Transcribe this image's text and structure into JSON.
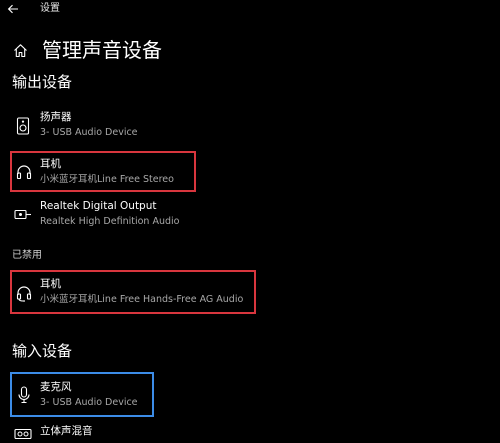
{
  "window": {
    "title": "设置"
  },
  "page": {
    "title": "管理声音设备"
  },
  "sections": {
    "output_heading": "输出设备",
    "disabled_label": "已禁用",
    "input_heading": "输入设备"
  },
  "output_devices": [
    {
      "name": "扬声器",
      "description": "3- USB Audio Device",
      "icon": "speaker-icon"
    },
    {
      "name": "耳机",
      "description": "小米蓝牙耳机Line Free Stereo",
      "icon": "headphones-icon"
    },
    {
      "name": "Realtek Digital Output",
      "description": "Realtek High Definition Audio",
      "icon": "digital-output-icon"
    }
  ],
  "disabled_devices": [
    {
      "name": "耳机",
      "description": "小米蓝牙耳机Line Free Hands-Free AG Audio",
      "icon": "headset-icon"
    }
  ],
  "input_devices": [
    {
      "name": "麦克风",
      "description": "3- USB Audio Device",
      "icon": "microphone-icon"
    },
    {
      "name": "立体声混音",
      "description": "",
      "icon": "stereo-mix-icon"
    }
  ],
  "colors": {
    "background": "#000000",
    "highlight_red": "#d9363e",
    "highlight_blue": "#3c8ce7",
    "secondary_text": "#a8a8a8"
  }
}
